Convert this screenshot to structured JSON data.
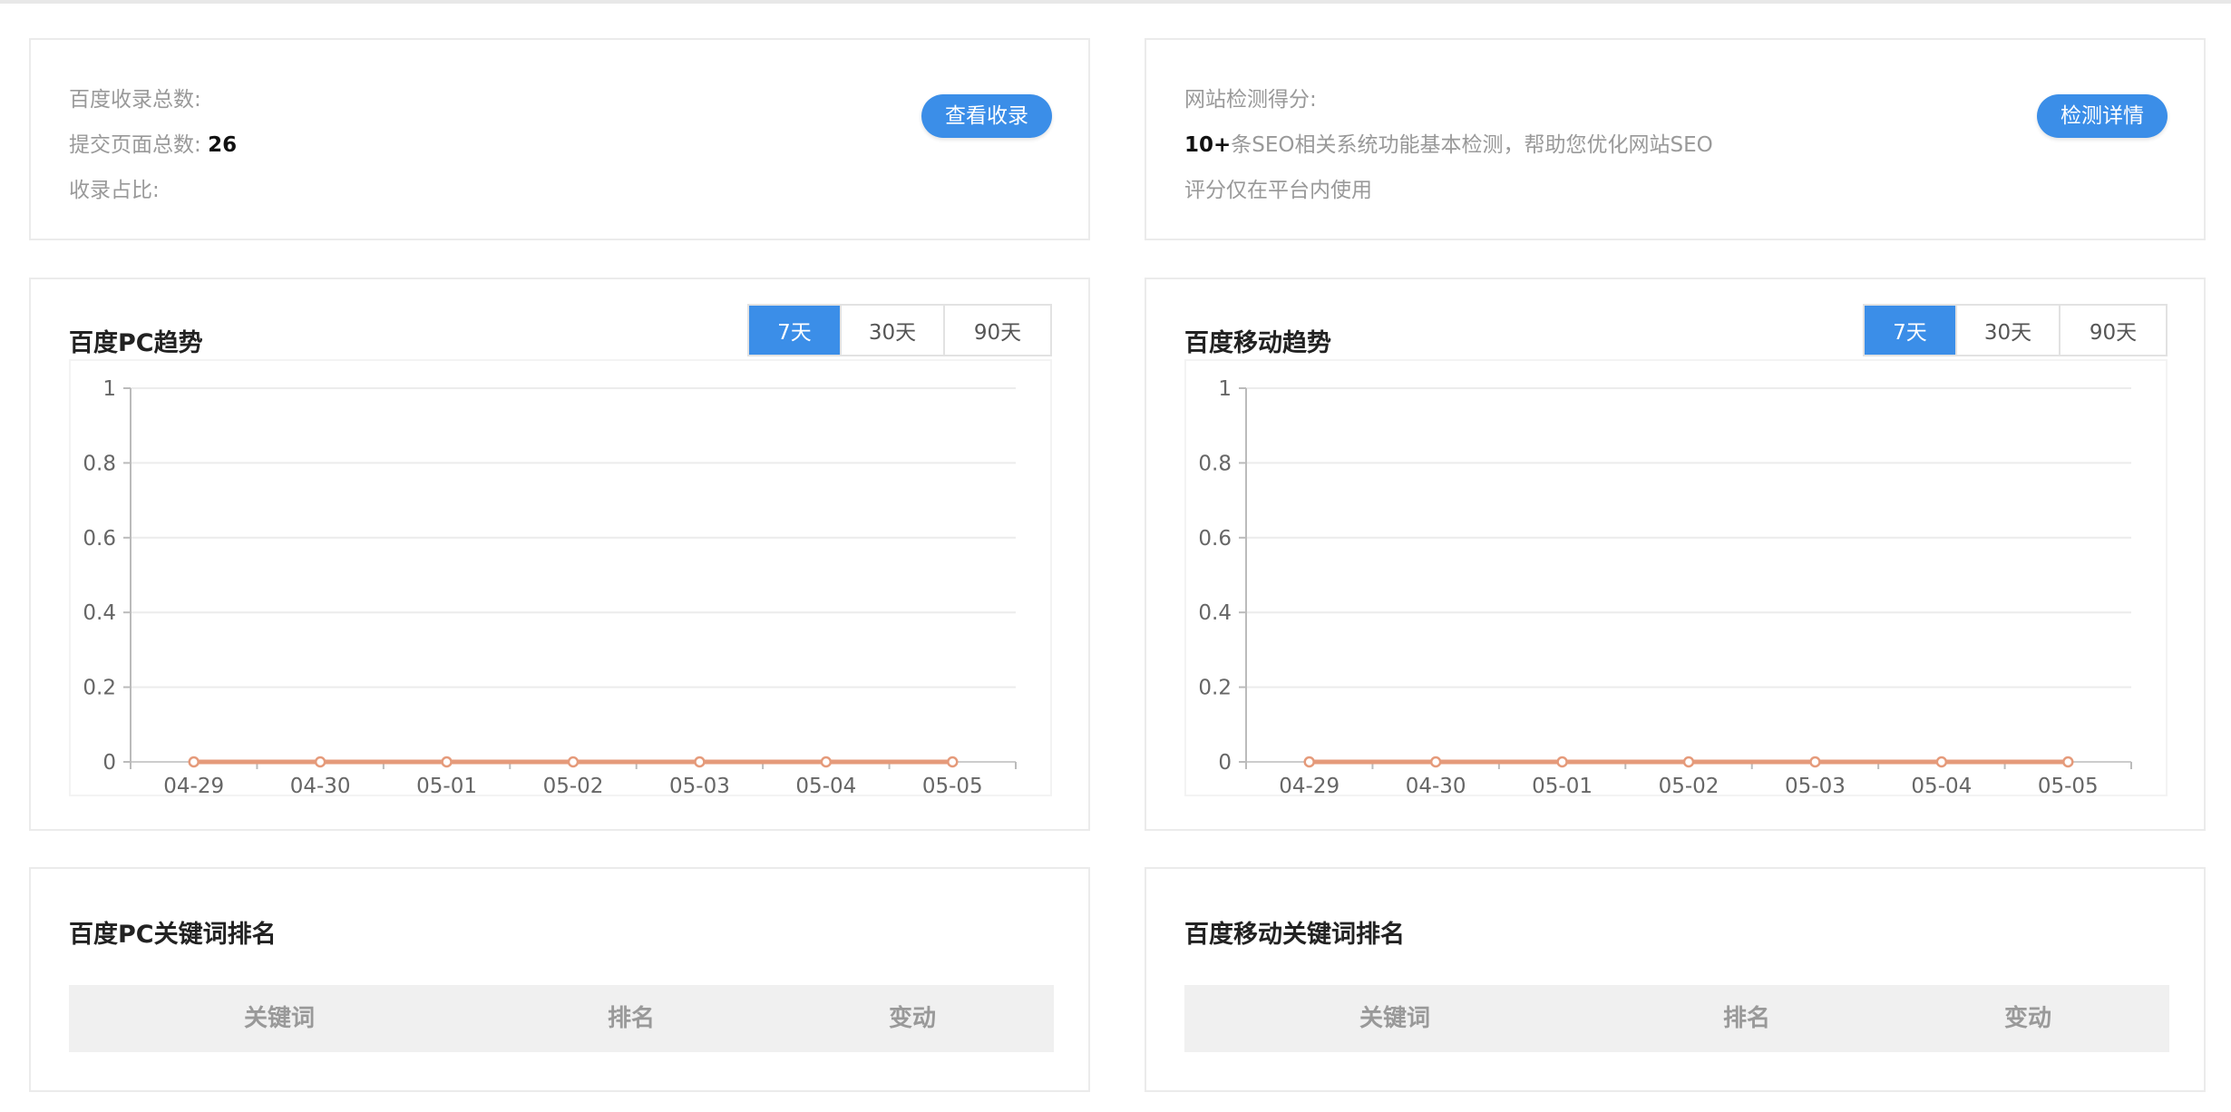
{
  "summary": {
    "baidu_index_label": "百度收录总数:",
    "submitted_label": "提交页面总数:",
    "submitted_value": "26",
    "ratio_label": "收录占比:",
    "view_button": "查看收录"
  },
  "detection": {
    "score_label": "网站检测得分:",
    "count_strong": "10+",
    "count_text": "条SEO相关系统功能基本检测，帮助您优化网站SEO",
    "note": "评分仅在平台内使用",
    "detail_button": "检测详情"
  },
  "pc_trend": {
    "title": "百度PC趋势",
    "ranges": [
      "7天",
      "30天",
      "90天"
    ],
    "active_range": 0
  },
  "mobile_trend": {
    "title": "百度移动趋势",
    "ranges": [
      "7天",
      "30天",
      "90天"
    ],
    "active_range": 0
  },
  "pc_keywords": {
    "title": "百度PC关键词排名",
    "columns": [
      "关键词",
      "排名",
      "变动"
    ]
  },
  "mobile_keywords": {
    "title": "百度移动关键词排名",
    "columns": [
      "关键词",
      "排名",
      "变动"
    ]
  },
  "chart_data": [
    {
      "type": "line",
      "categories": [
        "04-29",
        "04-30",
        "05-01",
        "05-02",
        "05-03",
        "05-04",
        "05-05"
      ],
      "series": [
        {
          "values": [
            0,
            0,
            0,
            0,
            0,
            0,
            0
          ]
        }
      ],
      "yticks": [
        "0",
        "0.2",
        "0.4",
        "0.6",
        "0.8",
        "1"
      ],
      "ylim": [
        0,
        1
      ],
      "grid": true,
      "line_color": "#e59a7a"
    },
    {
      "type": "line",
      "categories": [
        "04-29",
        "04-30",
        "05-01",
        "05-02",
        "05-03",
        "05-04",
        "05-05"
      ],
      "series": [
        {
          "values": [
            0,
            0,
            0,
            0,
            0,
            0,
            0
          ]
        }
      ],
      "yticks": [
        "0",
        "0.2",
        "0.4",
        "0.6",
        "0.8",
        "1"
      ],
      "ylim": [
        0,
        1
      ],
      "grid": true,
      "line_color": "#e59a7a"
    }
  ]
}
